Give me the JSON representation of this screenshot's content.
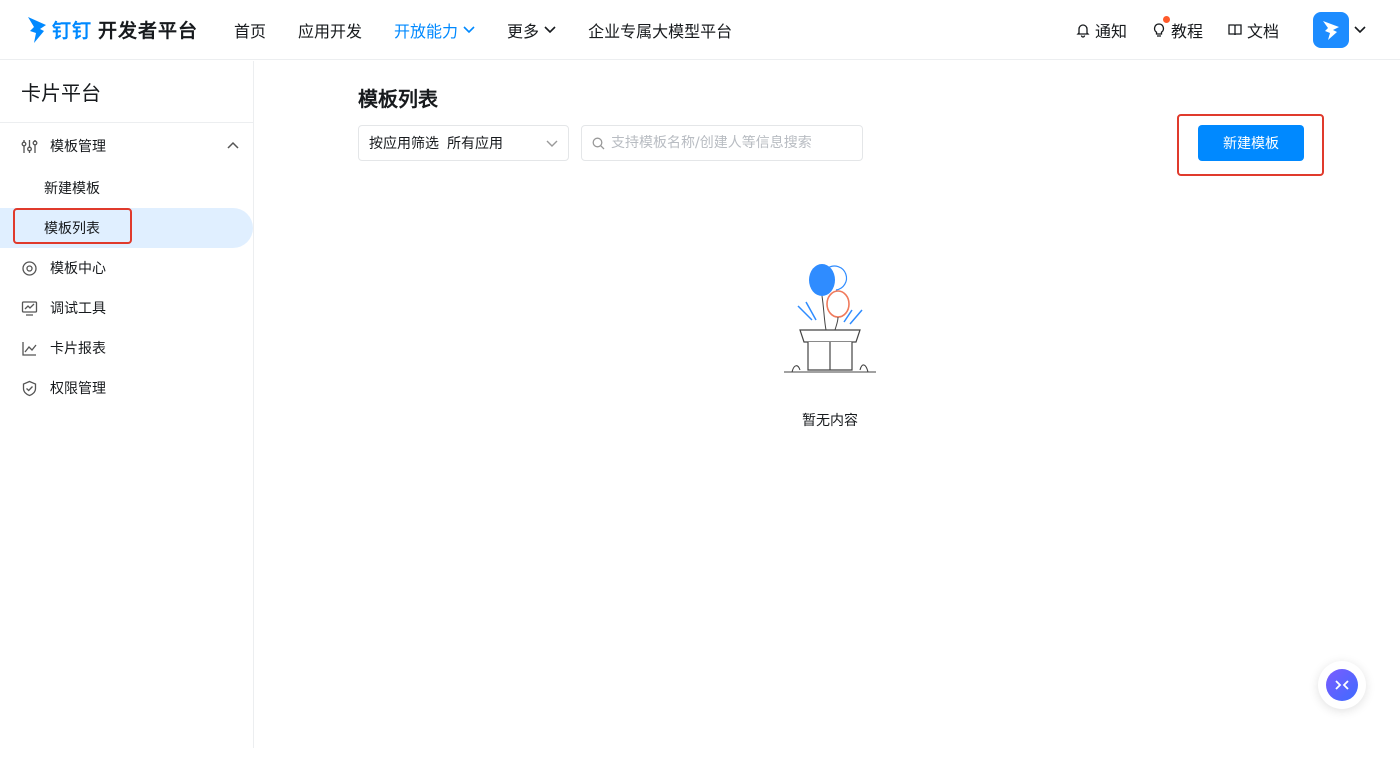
{
  "header": {
    "brand_name": "钉钉",
    "brand_sub": "开发者平台",
    "nav": [
      {
        "label": "首页"
      },
      {
        "label": "应用开发"
      },
      {
        "label": "开放能力"
      },
      {
        "label": "更多"
      },
      {
        "label": "企业专属大模型平台"
      }
    ],
    "notice": "通知",
    "tutorial": "教程",
    "docs": "文档"
  },
  "sidebar": {
    "title": "卡片平台",
    "group": {
      "label": "模板管理"
    },
    "sub_items": [
      {
        "label": "新建模板"
      },
      {
        "label": "模板列表"
      }
    ],
    "items": [
      {
        "label": "模板中心"
      },
      {
        "label": "调试工具"
      },
      {
        "label": "卡片报表"
      },
      {
        "label": "权限管理"
      }
    ]
  },
  "main": {
    "title": "模板列表",
    "filter_label": "按应用筛选",
    "filter_value": "所有应用",
    "search_placeholder": "支持模板名称/创建人等信息搜索",
    "create_button": "新建模板",
    "empty_text": "暂无内容"
  },
  "colors": {
    "accent": "#0089ff",
    "highlight_border": "#e03a2c",
    "active_bg": "#e0efff"
  }
}
